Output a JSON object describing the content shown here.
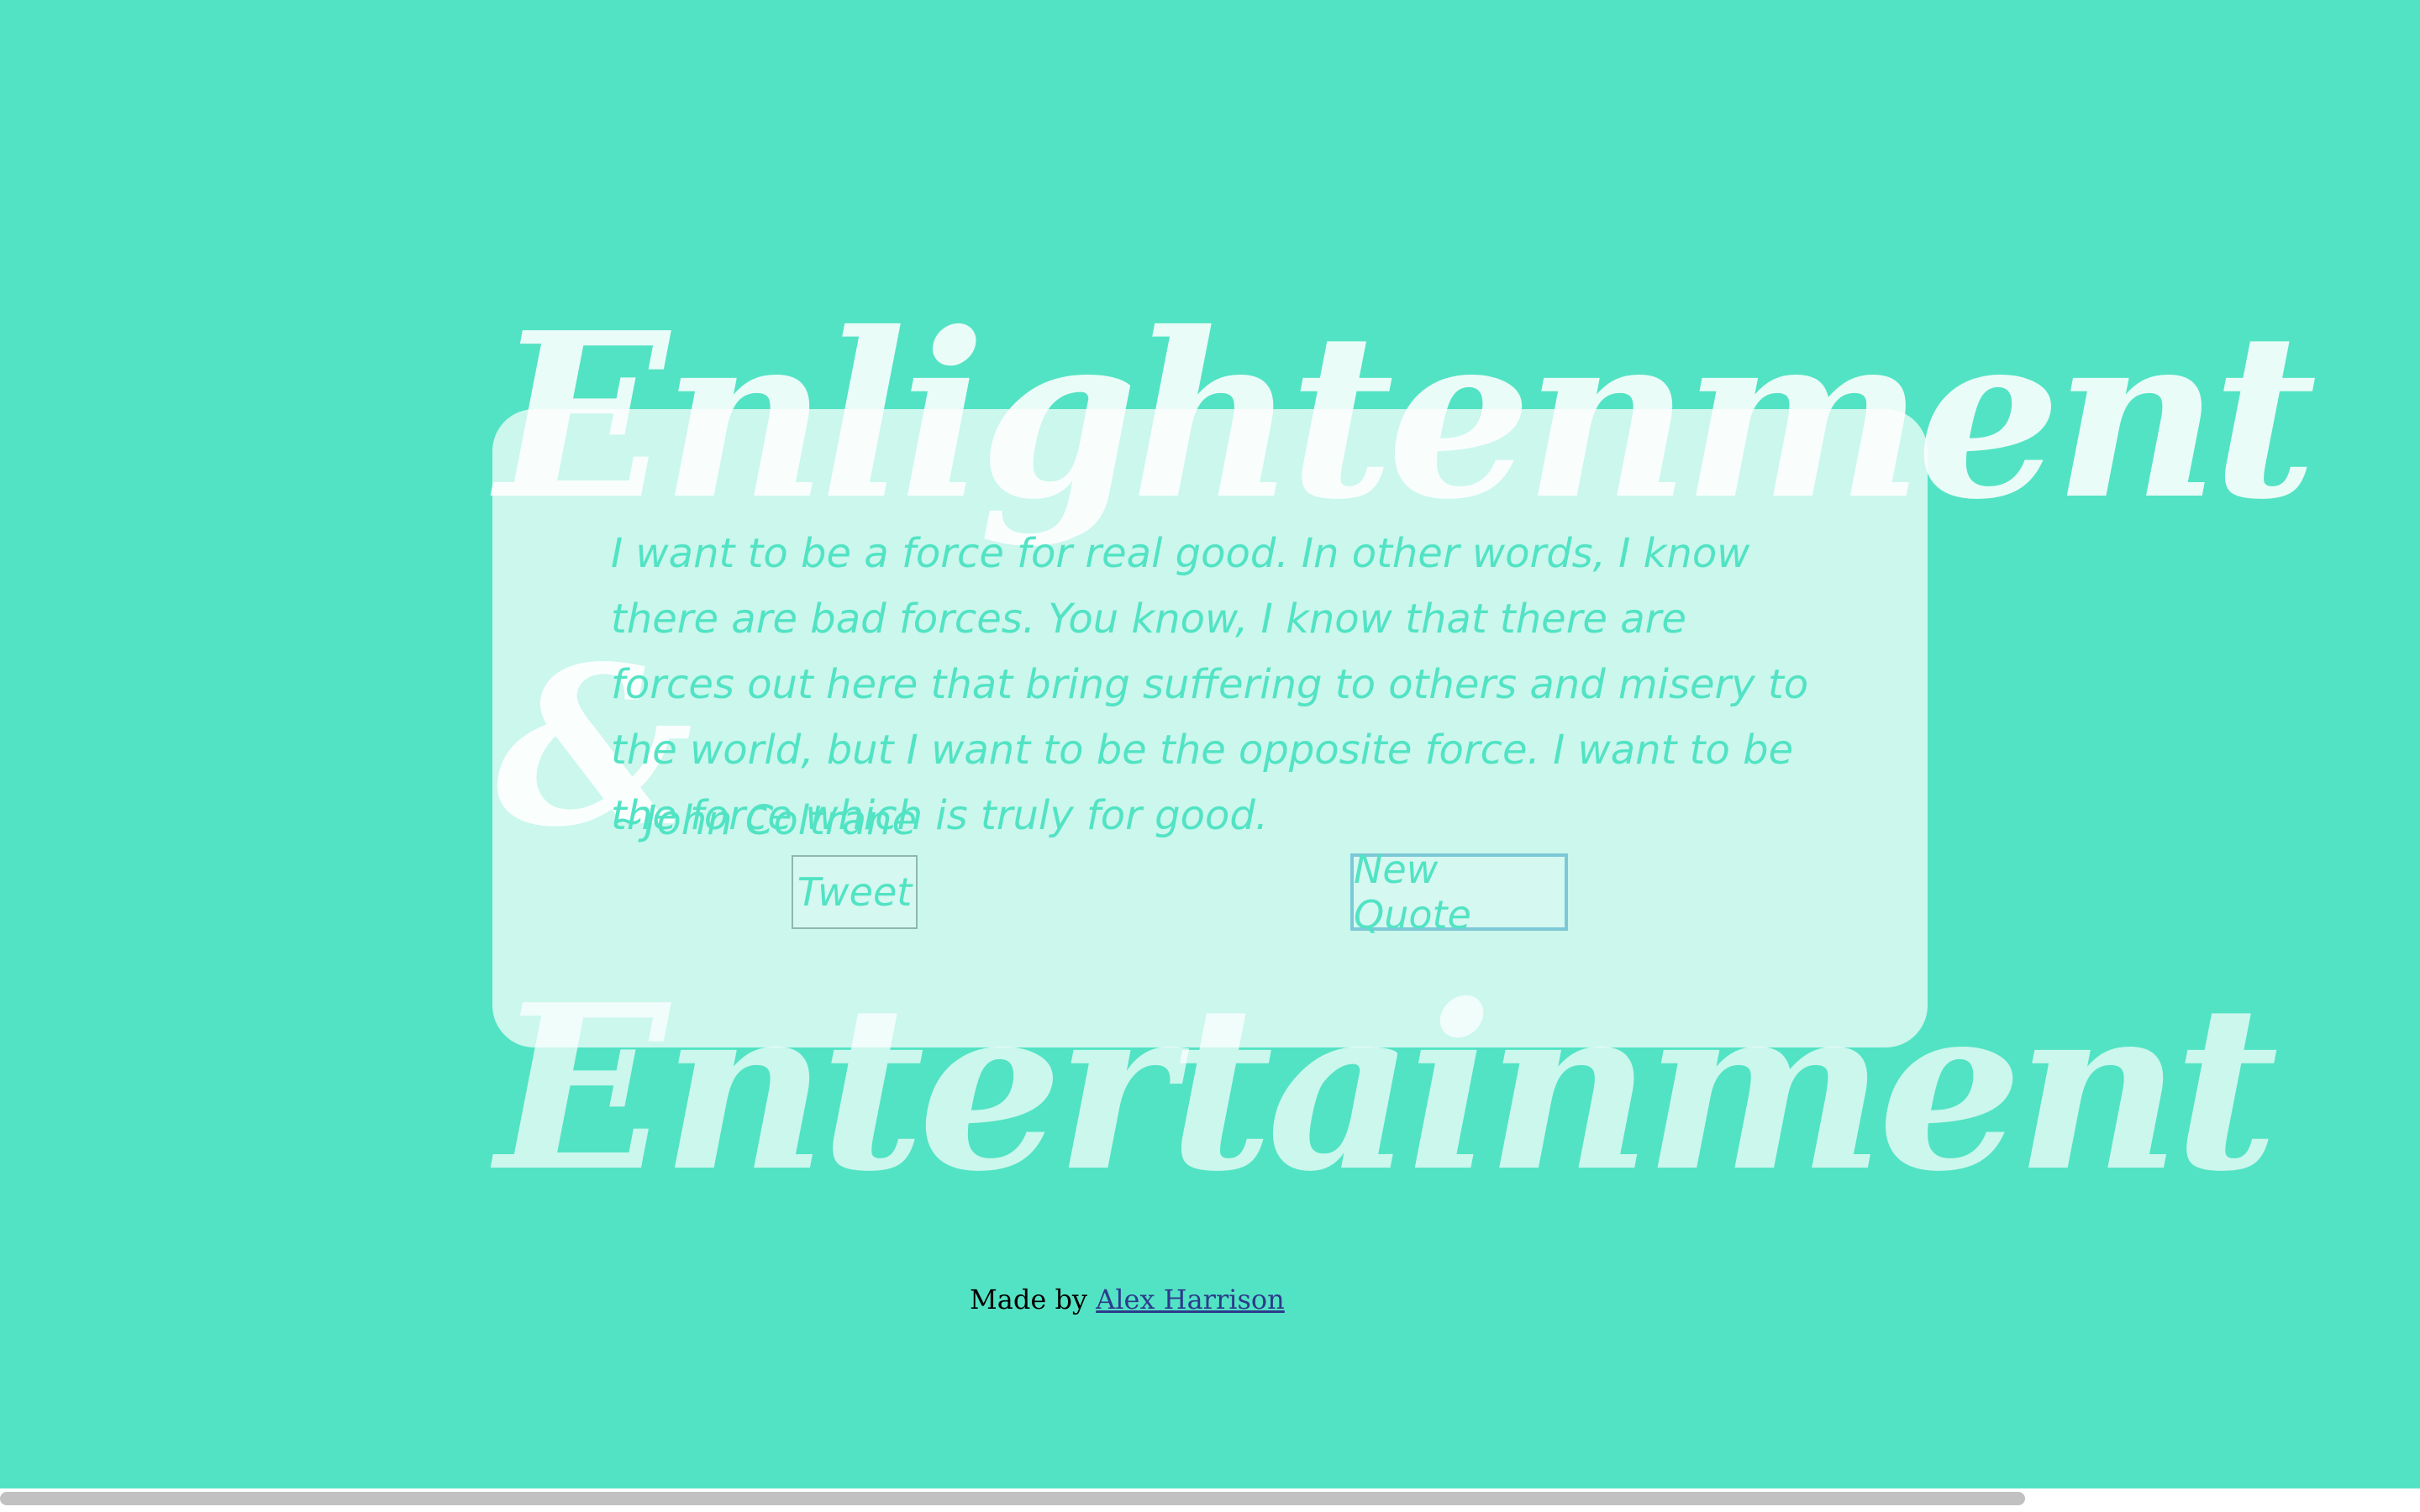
{
  "background_words": {
    "top": "Enlightenment",
    "middle": "&",
    "bottom": "Entertainment"
  },
  "quote": {
    "text": "I want to be a force for real good. In other words, I know there are bad forces. You know, I know that there are forces out here that bring suffering to others and misery to the world, but I want to be the opposite force. I want to be the force which is truly for good.",
    "author": "~John Coltrane"
  },
  "buttons": {
    "tweet_label": "Tweet",
    "new_quote_label": "New Quote"
  },
  "footer": {
    "prefix": "Made by",
    "link_text": "Alex Harrison"
  },
  "colors": {
    "background": "#52e3c4",
    "accent": "#52e3c4",
    "link": "#2d3a8c"
  }
}
